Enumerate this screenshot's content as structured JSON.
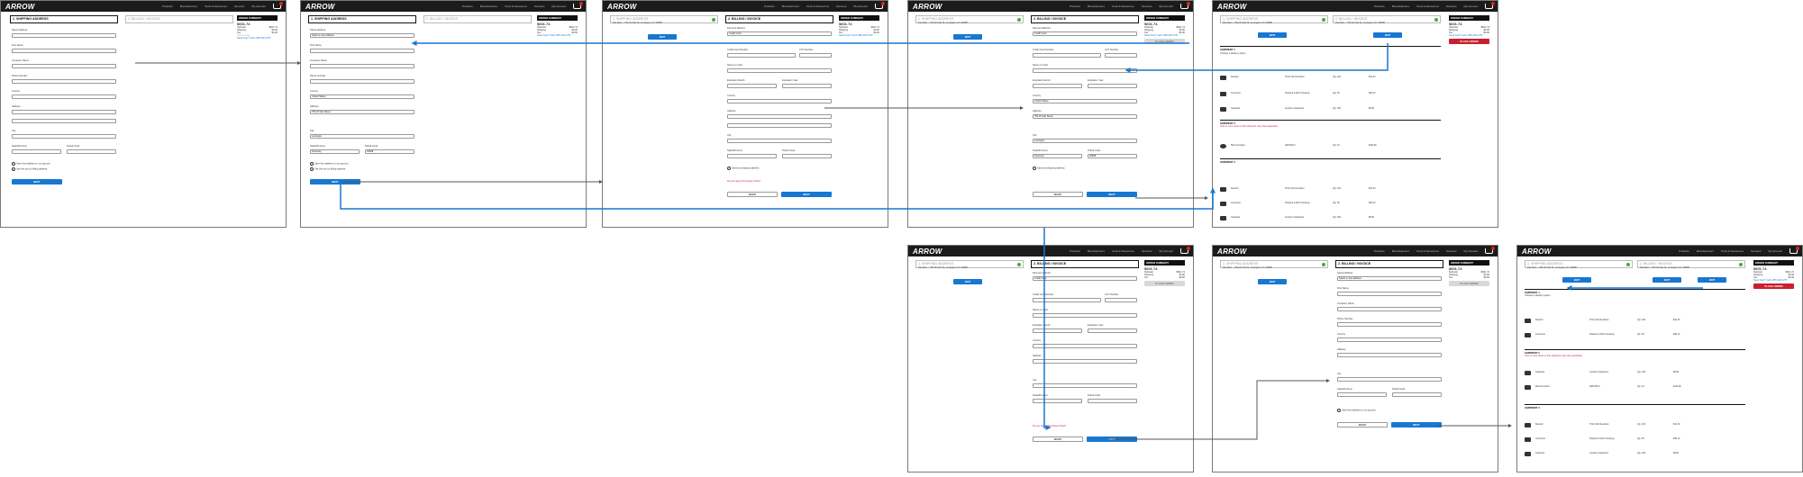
{
  "header": {
    "logo": "ARROW",
    "nav": [
      "Products",
      "Manufacturers",
      "Tools & Resources",
      "Services",
      "My Account"
    ]
  },
  "steps": {
    "shipping": "1. SHIPPING ADDRESS",
    "billing": "2. BILLING / INVOICE",
    "shipping_summary": "Pat Allen – 754 W Oak St, Lexington, KY 40508",
    "billing_summary": "Pat Allen – 754 W Oak St, Lexington, KY 40508"
  },
  "shipping_form": {
    "saved_label": "Saved address",
    "saved_value": "Select a new address",
    "first_name": "First Name",
    "last_name": "Last Name",
    "company": "Company Name",
    "phone": "Phone Number",
    "country": "Country",
    "country_value": "United States",
    "address": "Address",
    "address_value": "754 W Oak Street",
    "address2": "Address 2",
    "city": "City",
    "city_value": "Lexington",
    "state": "State/Province",
    "state_value": "Kentucky",
    "zip": "Postal Code",
    "zip_value": "40508",
    "save_checkbox": "Save this address to my account",
    "billing_checkbox": "Use this as my billing address",
    "next": "NEXT"
  },
  "billing_form": {
    "payment_label": "Payment Method",
    "payment_value": "Credit Card",
    "card_number": "Credit Card Number",
    "cvv": "CVV Number",
    "name_on_card": "Name on Card",
    "expiration_month": "Expiration Month",
    "expiration_year": "Expiration Year",
    "country": "Country",
    "address": "Address",
    "city": "City",
    "state": "State/Province",
    "zip": "Postal Code",
    "same_as_shipping": "Same as shipping address",
    "terms_text": "Do you have a Purchase Order?",
    "back": "BACK",
    "next": "NEXT"
  },
  "summary": {
    "title": "ORDER SUMMARY",
    "items_label": "Items",
    "total": "$601.74",
    "subtotal_label": "Subtotal",
    "subtotal": "$601.74",
    "shipping_label": "Shipping",
    "shipping": "$0.00",
    "tax_label": "Tax",
    "tax": "$0.00",
    "promo_label": "Promo code",
    "help": "Need help? Call 1-855-326-4757",
    "place_order": "PLACE ORDER"
  },
  "review": {
    "shipment1": "SHIPMENT 1",
    "shipment2": "SHIPMENT 2",
    "shipment3": "SHIPMENT 3",
    "delivery_label": "Choose a delivery option",
    "items": [
      {
        "name": "Resistor",
        "desc": "Thick Film Resistors",
        "qty": "Qty: 100",
        "price": "$12.40"
      },
      {
        "name": "Connector",
        "desc": "Headers & Wire Housings",
        "qty": "Qty: 50",
        "price": "$45.10"
      },
      {
        "name": "Capacitor",
        "desc": "Ceramic Capacitors",
        "qty": "Qty: 200",
        "price": "$8.90"
      },
      {
        "name": "Microcontroller",
        "desc": "ARM MCU",
        "qty": "Qty: 10",
        "price": "$120.00"
      }
    ],
    "warning": "One or more items in this shipment may ship separately"
  }
}
